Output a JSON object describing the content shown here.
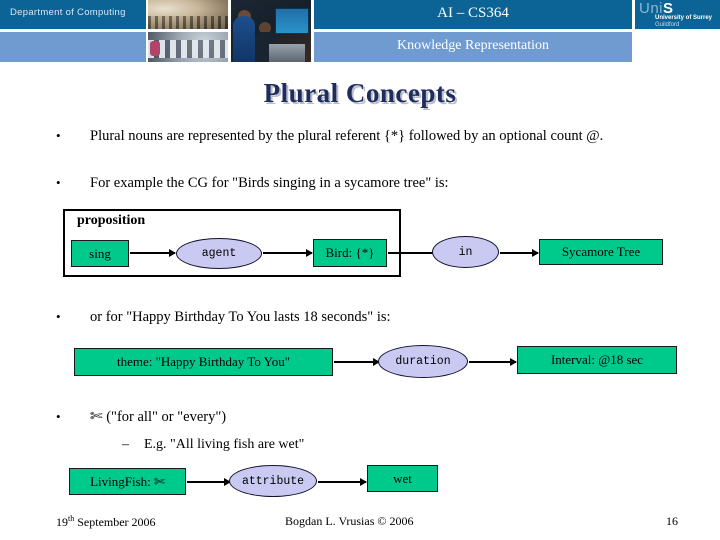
{
  "header": {
    "department": "Department of Computing",
    "course_title": "AI – CS364",
    "course_subtitle": "Knowledge Representation",
    "logo": {
      "mark_prefix": "Uni",
      "mark_suffix": "S",
      "line1": "University of Surrey",
      "line2": "Guildford"
    },
    "colors": {
      "dark_blue": "#0B6396",
      "light_blue": "#6F9BD1"
    }
  },
  "slide": {
    "title": "Plural Concepts",
    "title_color": "#1F2D5C"
  },
  "bullets": {
    "b1": "Plural nouns are represented by the plural referent {*} followed by an optional count @.",
    "b2": "For example the CG for \"Birds singing in a sycamore tree\" is:",
    "b3": "or for \"Happy Birthday To You lasts 18 seconds\" is:",
    "b4_suffix": "(\"for all\" or \"every\")",
    "b4_symbol": "✄",
    "sub1": "E.g. \"All living fish are wet\"",
    "dot": "•",
    "dash": "–"
  },
  "diagram1": {
    "frame_label": "proposition",
    "node_sing": "sing",
    "relation_agent": "agent",
    "node_bird": "Bird: {*}",
    "relation_in": "in",
    "node_sycamore": "Sycamore Tree",
    "concept_color": "#00C98C",
    "relation_color": "#C9C9F2"
  },
  "diagram2": {
    "node_theme": "theme: \"Happy Birthday To You\"",
    "relation_duration": "duration",
    "node_interval": "Interval: @18 sec"
  },
  "diagram3": {
    "node_livingfish": "LivingFish: ✄",
    "relation_attribute": "attribute",
    "node_wet": "wet"
  },
  "footer": {
    "date_num": "19",
    "date_sup": "th",
    "date_rest": " September 2006",
    "author": "Bogdan L. Vrusias © 2006",
    "page": "16"
  }
}
